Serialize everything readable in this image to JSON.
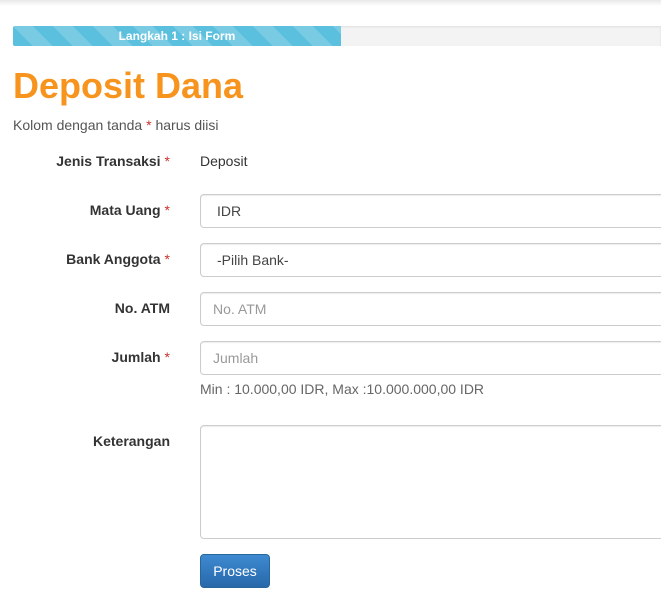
{
  "progress": {
    "label": "Langkah 1 : Isi Form",
    "percent": 50.6,
    "color": "#5bc0de"
  },
  "page": {
    "title": "Deposit Dana",
    "title_color": "#f7941d",
    "required_note_prefix": "Kolom dengan tanda",
    "required_marker": "*",
    "required_note_suffix": "harus diisi"
  },
  "form": {
    "jenis_transaksi": {
      "label": "Jenis Transaksi",
      "value": "Deposit"
    },
    "mata_uang": {
      "label": "Mata Uang",
      "value": "IDR"
    },
    "bank_anggota": {
      "label": "Bank Anggota",
      "value": "-Pilih Bank-"
    },
    "no_atm": {
      "label": "No. ATM",
      "placeholder": "No. ATM"
    },
    "jumlah": {
      "label": "Jumlah",
      "placeholder": "Jumlah",
      "help": "Min : 10.000,00 IDR, Max :10.000.000,00 IDR"
    },
    "keterangan": {
      "label": "Keterangan",
      "value": ""
    },
    "submit_label": "Proses",
    "submit_color": "#337ab7"
  }
}
